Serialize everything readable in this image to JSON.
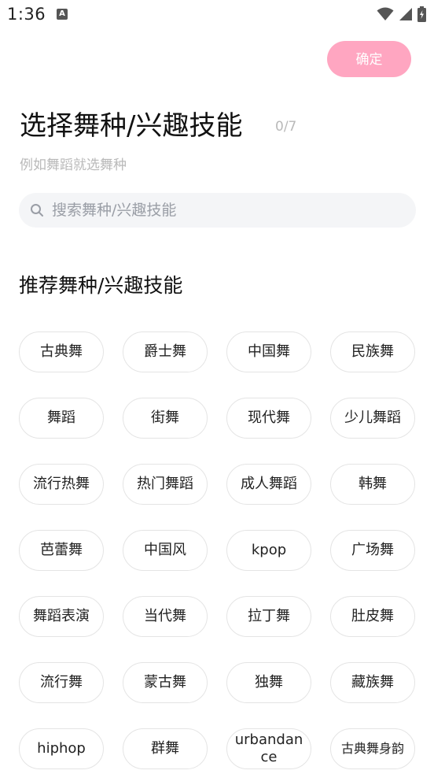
{
  "status_bar": {
    "time": "1:36",
    "notification_glyph": "A",
    "icons": [
      "wifi-icon",
      "cell-signal-icon",
      "battery-charging-icon"
    ]
  },
  "header": {
    "confirm_label": "确定",
    "title": "选择舞种/兴趣技能",
    "count": "0/7",
    "subtitle": "例如舞蹈就选舞种"
  },
  "search": {
    "placeholder": "搜索舞种/兴趣技能",
    "value": ""
  },
  "recommend": {
    "title": "推荐舞种/兴趣技能",
    "tags": [
      "古典舞",
      "爵士舞",
      "中国舞",
      "民族舞",
      "舞蹈",
      "街舞",
      "现代舞",
      "少儿舞蹈",
      "流行热舞",
      "热门舞蹈",
      "成人舞蹈",
      "韩舞",
      "芭蕾舞",
      "中国风",
      "kpop",
      "广场舞",
      "舞蹈表演",
      "当代舞",
      "拉丁舞",
      "肚皮舞",
      "流行舞",
      "蒙古舞",
      "独舞",
      "藏族舞",
      "hiphop",
      "群舞",
      "urbandance",
      "古典舞身韵"
    ]
  },
  "colors": {
    "accent": "#ffa6c1",
    "muted_text": "#b9b9b9",
    "search_bg": "#f4f5f7"
  }
}
